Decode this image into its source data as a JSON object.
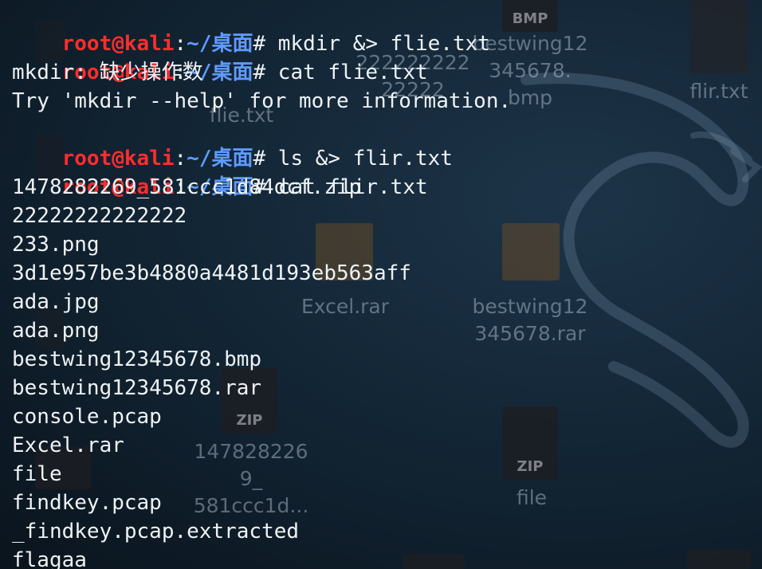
{
  "prompt": {
    "user_host": "root@kali",
    "separator": ":",
    "path": "~/桌面",
    "symbol": "#"
  },
  "commands": [
    " mkdir &> flie.txt",
    " cat flie.txt",
    " ls &> flir.txt",
    " cat flir.txt"
  ],
  "error_output": [
    "mkdir: 缺少操作数",
    "Try 'mkdir --help' for more information."
  ],
  "file_listing": [
    "1478282269_581ccc1d84dcf.zip",
    "22222222222222",
    "233.png",
    "3d1e957be3b4880a4481d193eb563aff",
    "ada.jpg",
    "ada.png",
    "bestwing12345678.bmp",
    "bestwing12345678.rar",
    "console.pcap",
    "Excel.rar",
    "file",
    "findkey.pcap",
    "_findkey.pcap.extracted",
    "flagaa"
  ],
  "desktop_icons": {
    "bmp_badge": "BMP",
    "bestwing_bmp": {
      "line1": "bestwing12",
      "line2": "345678.",
      "line3": "bmp"
    },
    "flir_txt": "flir.txt",
    "dir_2222": {
      "line1": "222222222",
      "line2": "22222"
    },
    "flie_txt": "flie.txt",
    "excel_rar": "Excel.rar",
    "bestwing_rar": {
      "line1": "bestwing12",
      "line2": "345678.rar"
    },
    "zip_badge": "ZIP",
    "zip_1478": {
      "line1": "147828226",
      "line2": "9_",
      "line3": "581ccc1d..."
    },
    "file_zip": "file"
  },
  "colors": {
    "prompt_user": "#ff2d2d",
    "prompt_path": "#5f9bff",
    "text": "#eef2f5"
  }
}
